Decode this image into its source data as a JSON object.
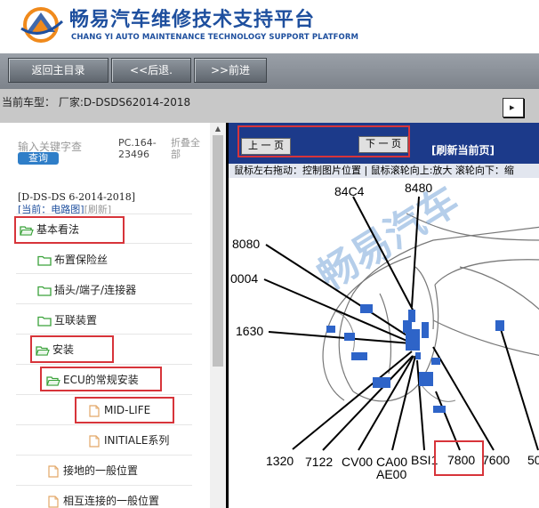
{
  "header": {
    "title": "畅易汽车维修技术支持平台",
    "subtitle": "CHANG YI AUTO MAINTENANCE TECHNOLOGY SUPPORT PLATFORM"
  },
  "toolbar": {
    "home": "返回主目录",
    "back": "<<后退.",
    "forward": ">>前进"
  },
  "model_bar": {
    "text": "当前车型：  厂家:D-DSDS62014-2018"
  },
  "sidebar": {
    "search_placeholder": "输入关键字查",
    "search_button": "查询",
    "pc_code": "PC.164-23496",
    "collapse_all": "折叠全部",
    "model_id": "[D-DS-DS 6-2014-2018]",
    "current_label": "[当前：电路图]",
    "refresh": "[刷新]",
    "tree": [
      {
        "label": "基本看法",
        "icon": "folder-open-icon"
      },
      {
        "label": "布置保险丝",
        "icon": "folder-icon"
      },
      {
        "label": "插头/端子/连接器",
        "icon": "folder-icon"
      },
      {
        "label": "互联装置",
        "icon": "folder-icon"
      },
      {
        "label": "安装",
        "icon": "folder-open-icon"
      },
      {
        "label": "ECU的常规安装",
        "icon": "folder-open-icon"
      },
      {
        "label": "MID-LIFE",
        "icon": "document-icon"
      },
      {
        "label": "INITIALE系列",
        "icon": "document-icon"
      },
      {
        "label": "接地的一般位置",
        "icon": "document-icon"
      },
      {
        "label": "相互连接的一般位置",
        "icon": "document-icon"
      }
    ]
  },
  "viewer": {
    "prev_page": "上 一 页",
    "next_page": "下 一 页",
    "refresh_page": "[刷新当前页]",
    "hint": "鼠标左右拖动：控制图片位置 | 鼠标滚轮向上:放大   滚轮向下：缩",
    "watermark": "畅易汽车",
    "labels": [
      "84C4",
      "8480",
      "8080",
      "0004",
      "1630",
      "1320",
      "7122",
      "CV00",
      "CA00",
      "AE00",
      "BSI1",
      "7800",
      "7600",
      "50"
    ]
  },
  "colors": {
    "brand_blue": "#1e4f9e",
    "highlight_red": "#d7343a",
    "nav_bar": "#1c3a8a",
    "component_blue": "#2e64c8"
  }
}
